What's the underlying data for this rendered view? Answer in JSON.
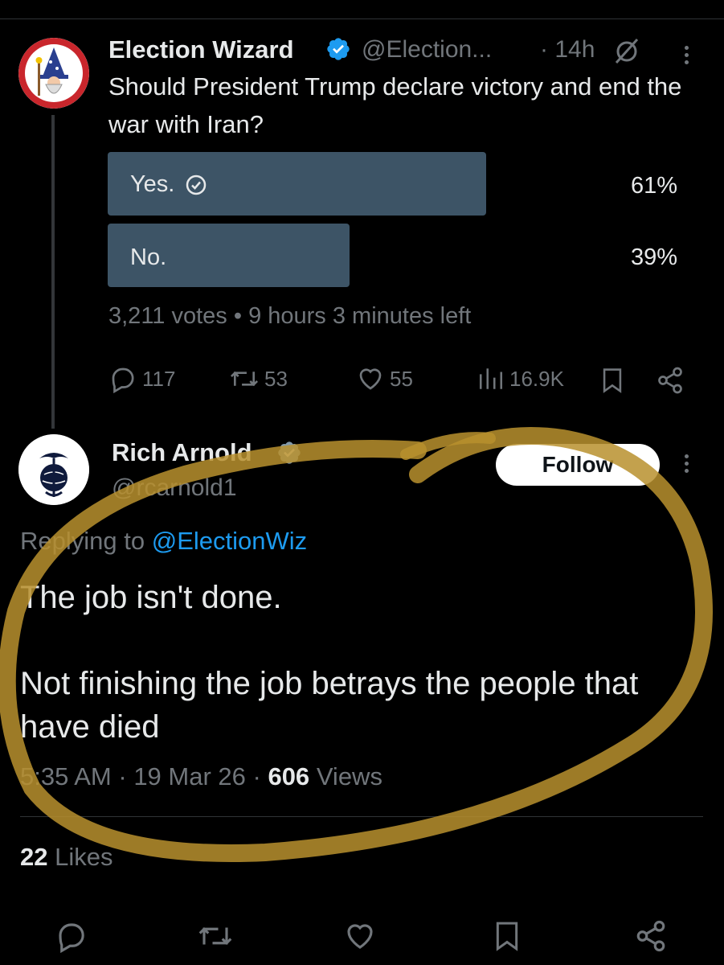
{
  "poll_tweet": {
    "author_name": "Election Wizard",
    "handle": "@Election...",
    "time": "· 14h",
    "text": "Should President Trump declare victory and end the war with Iran?",
    "options": [
      {
        "label": "Yes.",
        "percent": "61%",
        "share": 0.61,
        "selected": true
      },
      {
        "label": "No.",
        "percent": "39%",
        "share": 0.39,
        "selected": false
      }
    ],
    "votes": "3,211 votes",
    "time_left": "9 hours 3 minutes left",
    "stats": {
      "replies": "117",
      "reposts": "53",
      "likes": "55",
      "views": "16.9K"
    }
  },
  "reply_tweet": {
    "author_name": "Rich Arnold",
    "handle": "@rcarnold1",
    "follow_label": "Follow",
    "replying_prefix": "Replying to",
    "replying_handle": "@ElectionWiz",
    "paragraph1": "The job isn't done.",
    "paragraph2": "Not finishing the job betrays the people that have died",
    "time": "5:35 AM",
    "date": "19 Mar 26",
    "views_count": "606",
    "views_label": "Views",
    "likes_count": "22",
    "likes_label": "Likes"
  },
  "colors": {
    "background": "#000000",
    "poll_bar": "#3d5466",
    "verified_badge": "#1d9bf0",
    "verified_gold": "#829aab",
    "link": "#1d9bf0",
    "highlight_circle": "#b8902e"
  }
}
